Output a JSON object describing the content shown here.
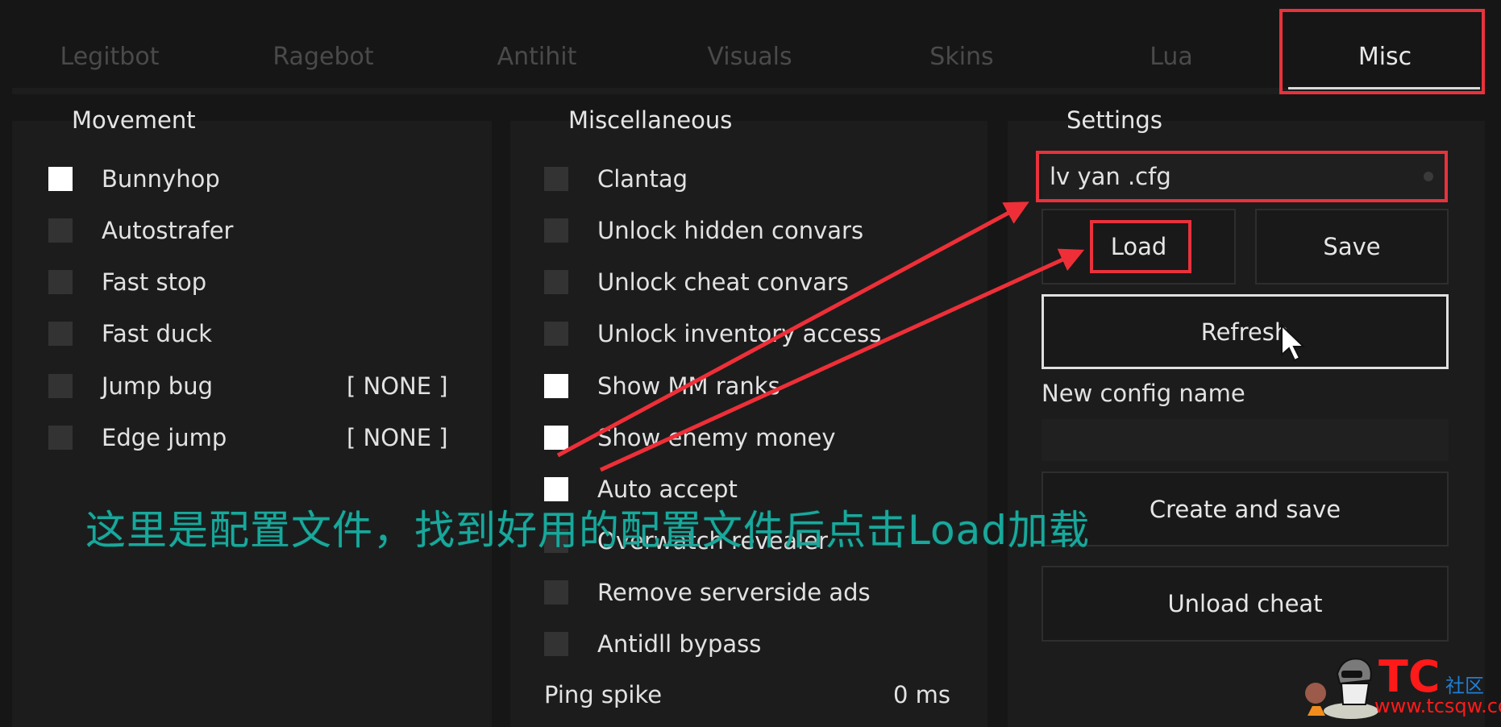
{
  "tabs": [
    {
      "label": "Legitbot",
      "active": false
    },
    {
      "label": "Ragebot",
      "active": false
    },
    {
      "label": "Antihit",
      "active": false
    },
    {
      "label": "Visuals",
      "active": false
    },
    {
      "label": "Skins",
      "active": false
    },
    {
      "label": "Lua",
      "active": false
    },
    {
      "label": "Misc",
      "active": true
    }
  ],
  "movement": {
    "title": "Movement",
    "items": [
      {
        "label": "Bunnyhop",
        "checked": true,
        "keybind": null
      },
      {
        "label": "Autostrafer",
        "checked": false,
        "keybind": null
      },
      {
        "label": "Fast stop",
        "checked": false,
        "keybind": null
      },
      {
        "label": "Fast duck",
        "checked": false,
        "keybind": null
      },
      {
        "label": "Jump bug",
        "checked": false,
        "keybind": "[ NONE ]"
      },
      {
        "label": "Edge jump",
        "checked": false,
        "keybind": "[ NONE ]"
      }
    ]
  },
  "miscellaneous": {
    "title": "Miscellaneous",
    "items": [
      {
        "label": "Clantag",
        "checked": false
      },
      {
        "label": "Unlock hidden convars",
        "checked": false
      },
      {
        "label": "Unlock cheat convars",
        "checked": false
      },
      {
        "label": "Unlock inventory access",
        "checked": false
      },
      {
        "label": "Show MM ranks",
        "checked": true
      },
      {
        "label": "Show enemy money",
        "checked": true
      },
      {
        "label": "Auto accept",
        "checked": true
      },
      {
        "label": "Overwatch revealer",
        "checked": false
      },
      {
        "label": "Remove serverside ads",
        "checked": false
      },
      {
        "label": "Antidll bypass",
        "checked": false
      }
    ],
    "ping_spike": {
      "label": "Ping spike",
      "value": "0 ms"
    }
  },
  "settings": {
    "title": "Settings",
    "selected_config": "lv yan .cfg",
    "load_label": "Load",
    "save_label": "Save",
    "refresh_label": "Refresh",
    "new_config_label": "New config name",
    "new_config_value": "",
    "create_label": "Create and save",
    "unload_label": "Unload cheat"
  },
  "annotation": {
    "caption": "这里是配置文件，找到好用的配置文件后点击Load加载",
    "highlight_color": "#e8323c",
    "caption_color": "#19a89b"
  },
  "watermark": {
    "logo": "TC",
    "community": "社区",
    "url": "www.tcsqw.com"
  }
}
